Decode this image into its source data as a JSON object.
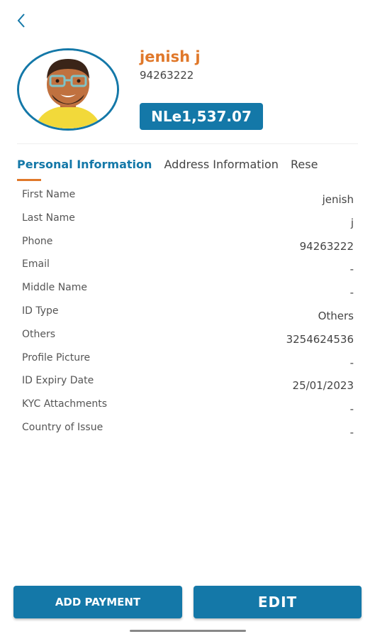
{
  "header": {
    "back_icon": "chevron-left-icon"
  },
  "profile": {
    "name": "jenish j",
    "msisdn": "94263222",
    "balance": "NLe1,537.07",
    "colors": {
      "accent": "#1478a8",
      "name": "#e0782a"
    }
  },
  "tabs": [
    {
      "label": "Personal Information",
      "active": true
    },
    {
      "label": "Address Information",
      "active": false
    },
    {
      "label": "Rese",
      "active": false
    }
  ],
  "fields": [
    {
      "label": "First Name",
      "value": "jenish"
    },
    {
      "label": "Last Name",
      "value": "j"
    },
    {
      "label": "Phone",
      "value": "94263222"
    },
    {
      "label": "Email",
      "value": "-"
    },
    {
      "label": "Middle Name",
      "value": "-"
    },
    {
      "label": "ID Type",
      "value": "Others"
    },
    {
      "label": "Others",
      "value": "3254624536"
    },
    {
      "label": "Profile Picture",
      "value": "-"
    },
    {
      "label": "ID Expiry Date",
      "value": "25/01/2023"
    },
    {
      "label": "KYC Attachments",
      "value": "-"
    },
    {
      "label": "Country of Issue",
      "value": "-"
    }
  ],
  "actions": {
    "add_payment": "ADD PAYMENT",
    "edit": "EDIT"
  }
}
